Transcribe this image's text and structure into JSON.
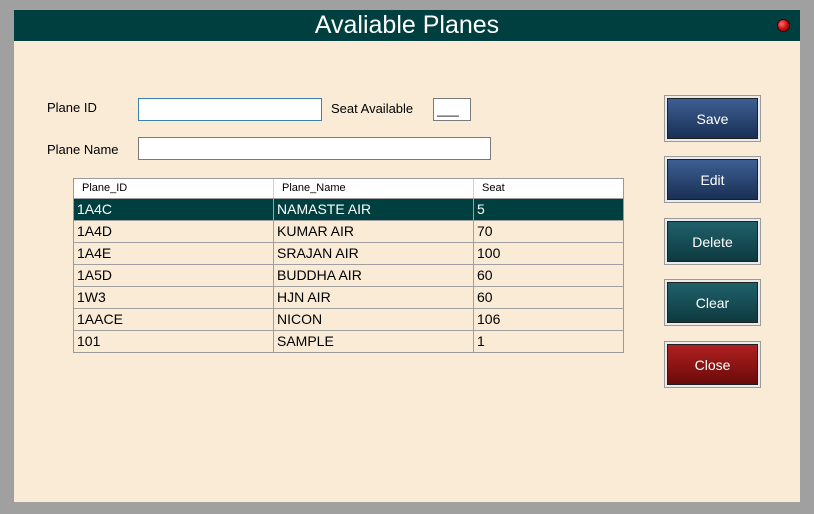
{
  "window": {
    "title": "Avaliable Planes"
  },
  "form": {
    "plane_id_label": "Plane ID",
    "plane_id_value": "",
    "seat_label": "Seat Available",
    "seat_value": "___",
    "plane_name_label": "Plane Name",
    "plane_name_value": ""
  },
  "grid": {
    "columns": [
      "Plane_ID",
      "Plane_Name",
      "Seat"
    ],
    "rows": [
      [
        "1A4C",
        "NAMASTE AIR",
        "5"
      ],
      [
        "1A4D",
        "KUMAR AIR",
        "70"
      ],
      [
        "1A4E",
        "SRAJAN AIR",
        "100"
      ],
      [
        "1A5D",
        "BUDDHA AIR",
        "60"
      ],
      [
        "1W3",
        "HJN AIR",
        "60"
      ],
      [
        "1AACE",
        "NICON",
        "106"
      ],
      [
        "101",
        "SAMPLE",
        "1"
      ]
    ],
    "selected_row": 0
  },
  "buttons": {
    "save": "Save",
    "edit": "Edit",
    "delete": "Delete",
    "clear": "Clear",
    "close": "Close"
  },
  "colors": {
    "title_bar": "#003f3f",
    "form_background": "#faebd7",
    "selected_row": "#003f3f",
    "save_edit_button": "#2a4a7a",
    "delete_clear_button": "#1a4d55",
    "close_button": "#8b1010"
  },
  "icons": {
    "window_close": "red-orb-close-icon"
  }
}
